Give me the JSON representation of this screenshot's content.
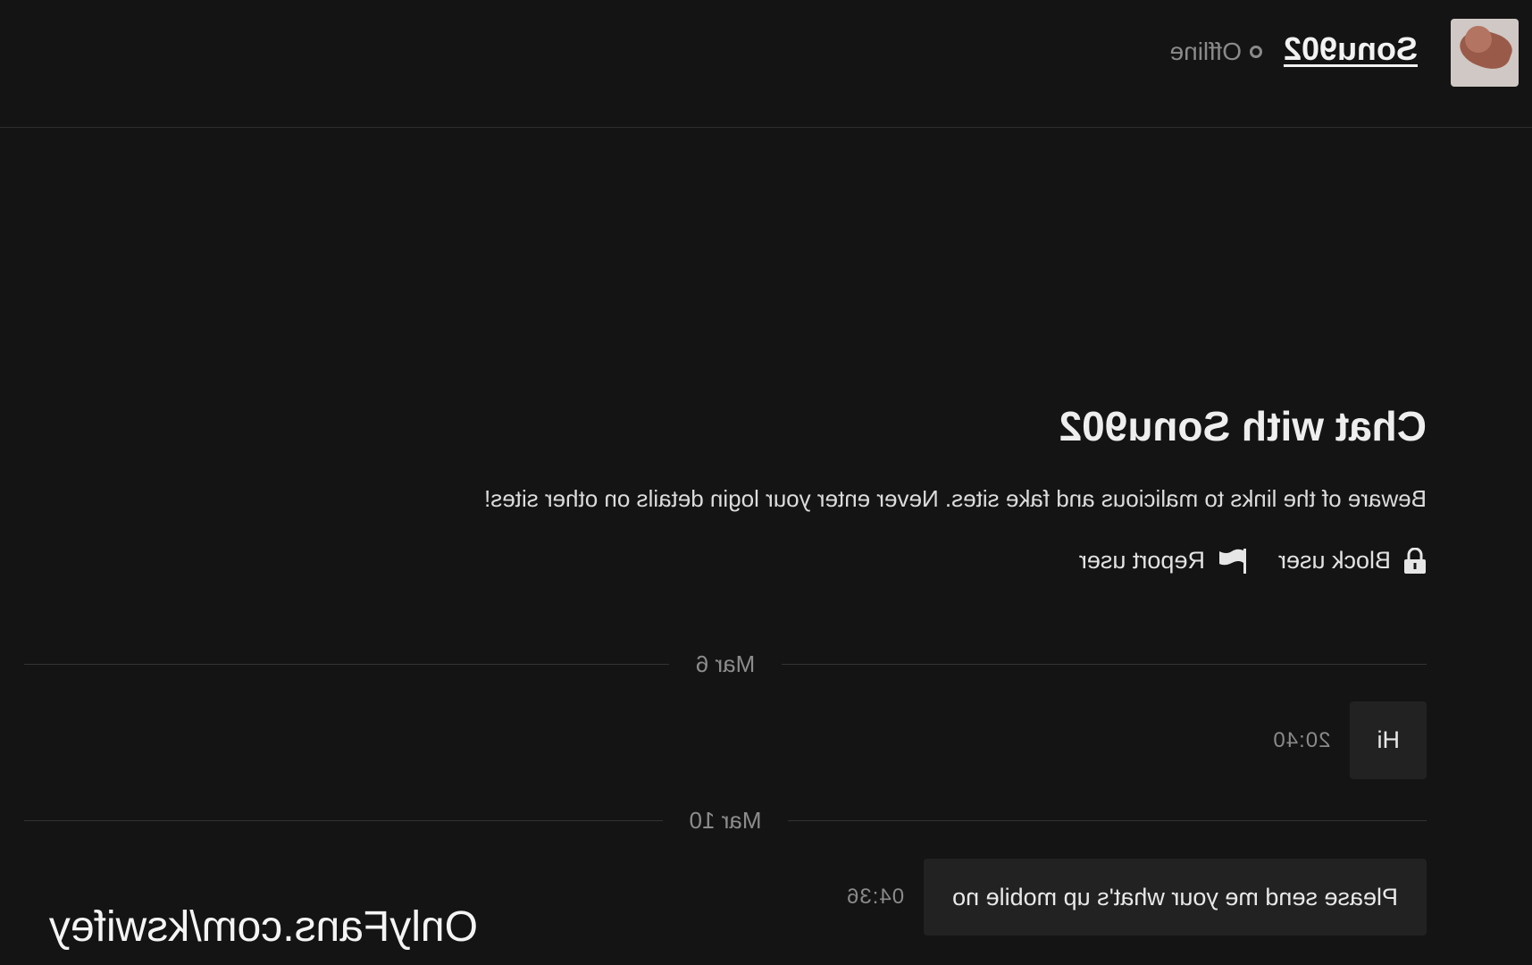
{
  "header": {
    "username": "Sonu902",
    "status": "Offline"
  },
  "intro": {
    "title": "Chat with Sonu902",
    "warning": "Beware of the links to malicious and fake sites. Never enter your login details on other sites!",
    "block_label": "Block user",
    "report_label": "Report user"
  },
  "messages": {
    "groups": [
      {
        "date": "Mar 6",
        "items": [
          {
            "text": "Hi",
            "time": "20:40"
          }
        ]
      },
      {
        "date": "Mar 10",
        "items": [
          {
            "text": "Please send me your what's up mobile no",
            "time": "04:36"
          }
        ]
      }
    ]
  },
  "watermark": "OnlyFans.com/kswifey",
  "colors": {
    "background": "#141414",
    "bubble": "#222222",
    "muted_text": "#8a8a8a"
  },
  "icons": [
    "lock-icon",
    "flag-icon",
    "status-dot-icon"
  ]
}
